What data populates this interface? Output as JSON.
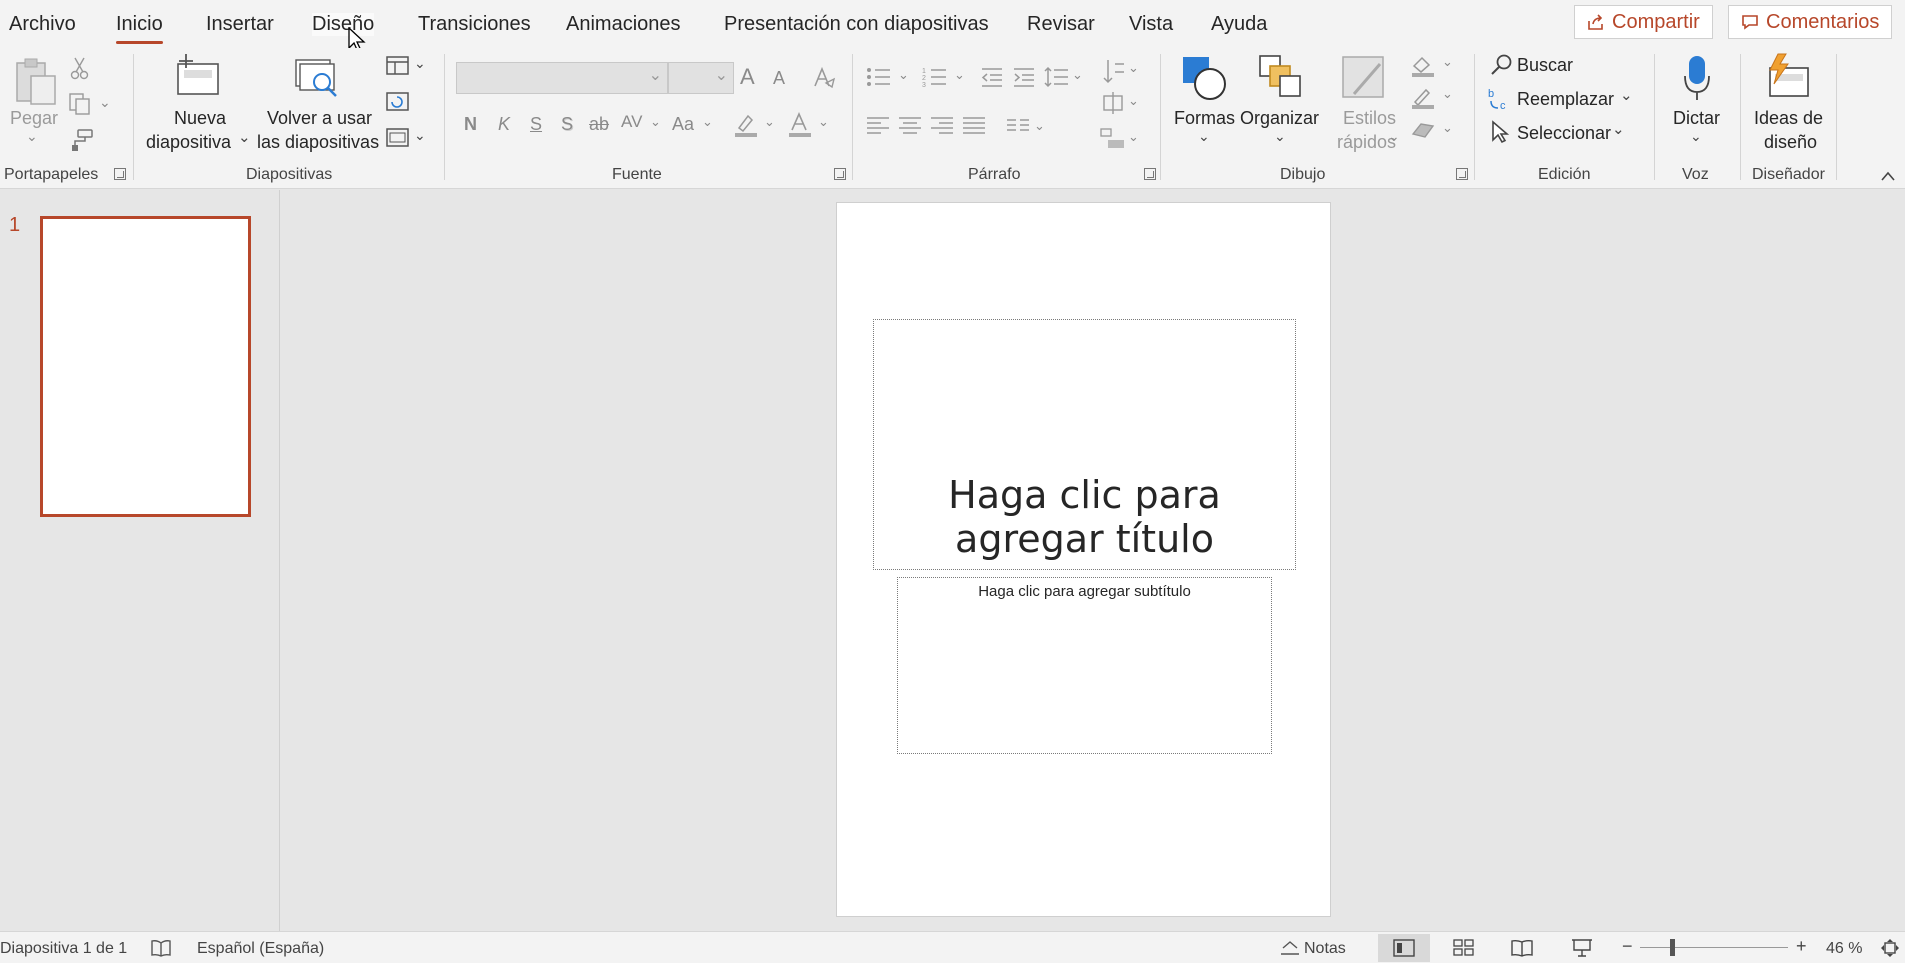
{
  "tabs": [
    "Archivo",
    "Inicio",
    "Insertar",
    "Diseño",
    "Transiciones",
    "Animaciones",
    "Presentación con diapositivas",
    "Revisar",
    "Vista",
    "Ayuda"
  ],
  "active_tab": "Inicio",
  "top_buttons": {
    "share": "Compartir",
    "comments": "Comentarios"
  },
  "accent_color": "#b7472a",
  "ribbon": {
    "groups": {
      "clipboard": "Portapapeles",
      "slides": "Diapositivas",
      "font": "Fuente",
      "paragraph": "Párrafo",
      "drawing": "Dibujo",
      "editing": "Edición",
      "voice": "Voz",
      "designer": "Diseñador"
    },
    "paste": "Pegar",
    "new_slide": [
      "Nueva",
      "diapositiva"
    ],
    "reuse_slides": [
      "Volver a usar",
      "las diapositivas"
    ],
    "shapes": "Formas",
    "arrange": "Organizar",
    "quick_styles": [
      "Estilos",
      "rápidos"
    ],
    "find": "Buscar",
    "replace": "Reemplazar",
    "select": "Seleccionar",
    "dictate": "Dictar",
    "design_ideas": [
      "Ideas de",
      "diseño"
    ],
    "font_buttons": {
      "bold": "N",
      "italic": "K",
      "underline": "S",
      "shadow": "S",
      "strike": "ab",
      "spacing": "AV",
      "case": "Aa",
      "grow": "A",
      "shrink": "A"
    }
  },
  "thumbnails": [
    {
      "number": "1"
    }
  ],
  "slide": {
    "title_placeholder": "Haga clic para agregar título",
    "subtitle_placeholder": "Haga clic para agregar subtítulo"
  },
  "status": {
    "slide_count": "Diapositiva 1 de 1",
    "language": "Español (España)",
    "notes": "Notas",
    "zoom_level": "46 %",
    "zoom_minus": "−",
    "zoom_plus": "+"
  }
}
